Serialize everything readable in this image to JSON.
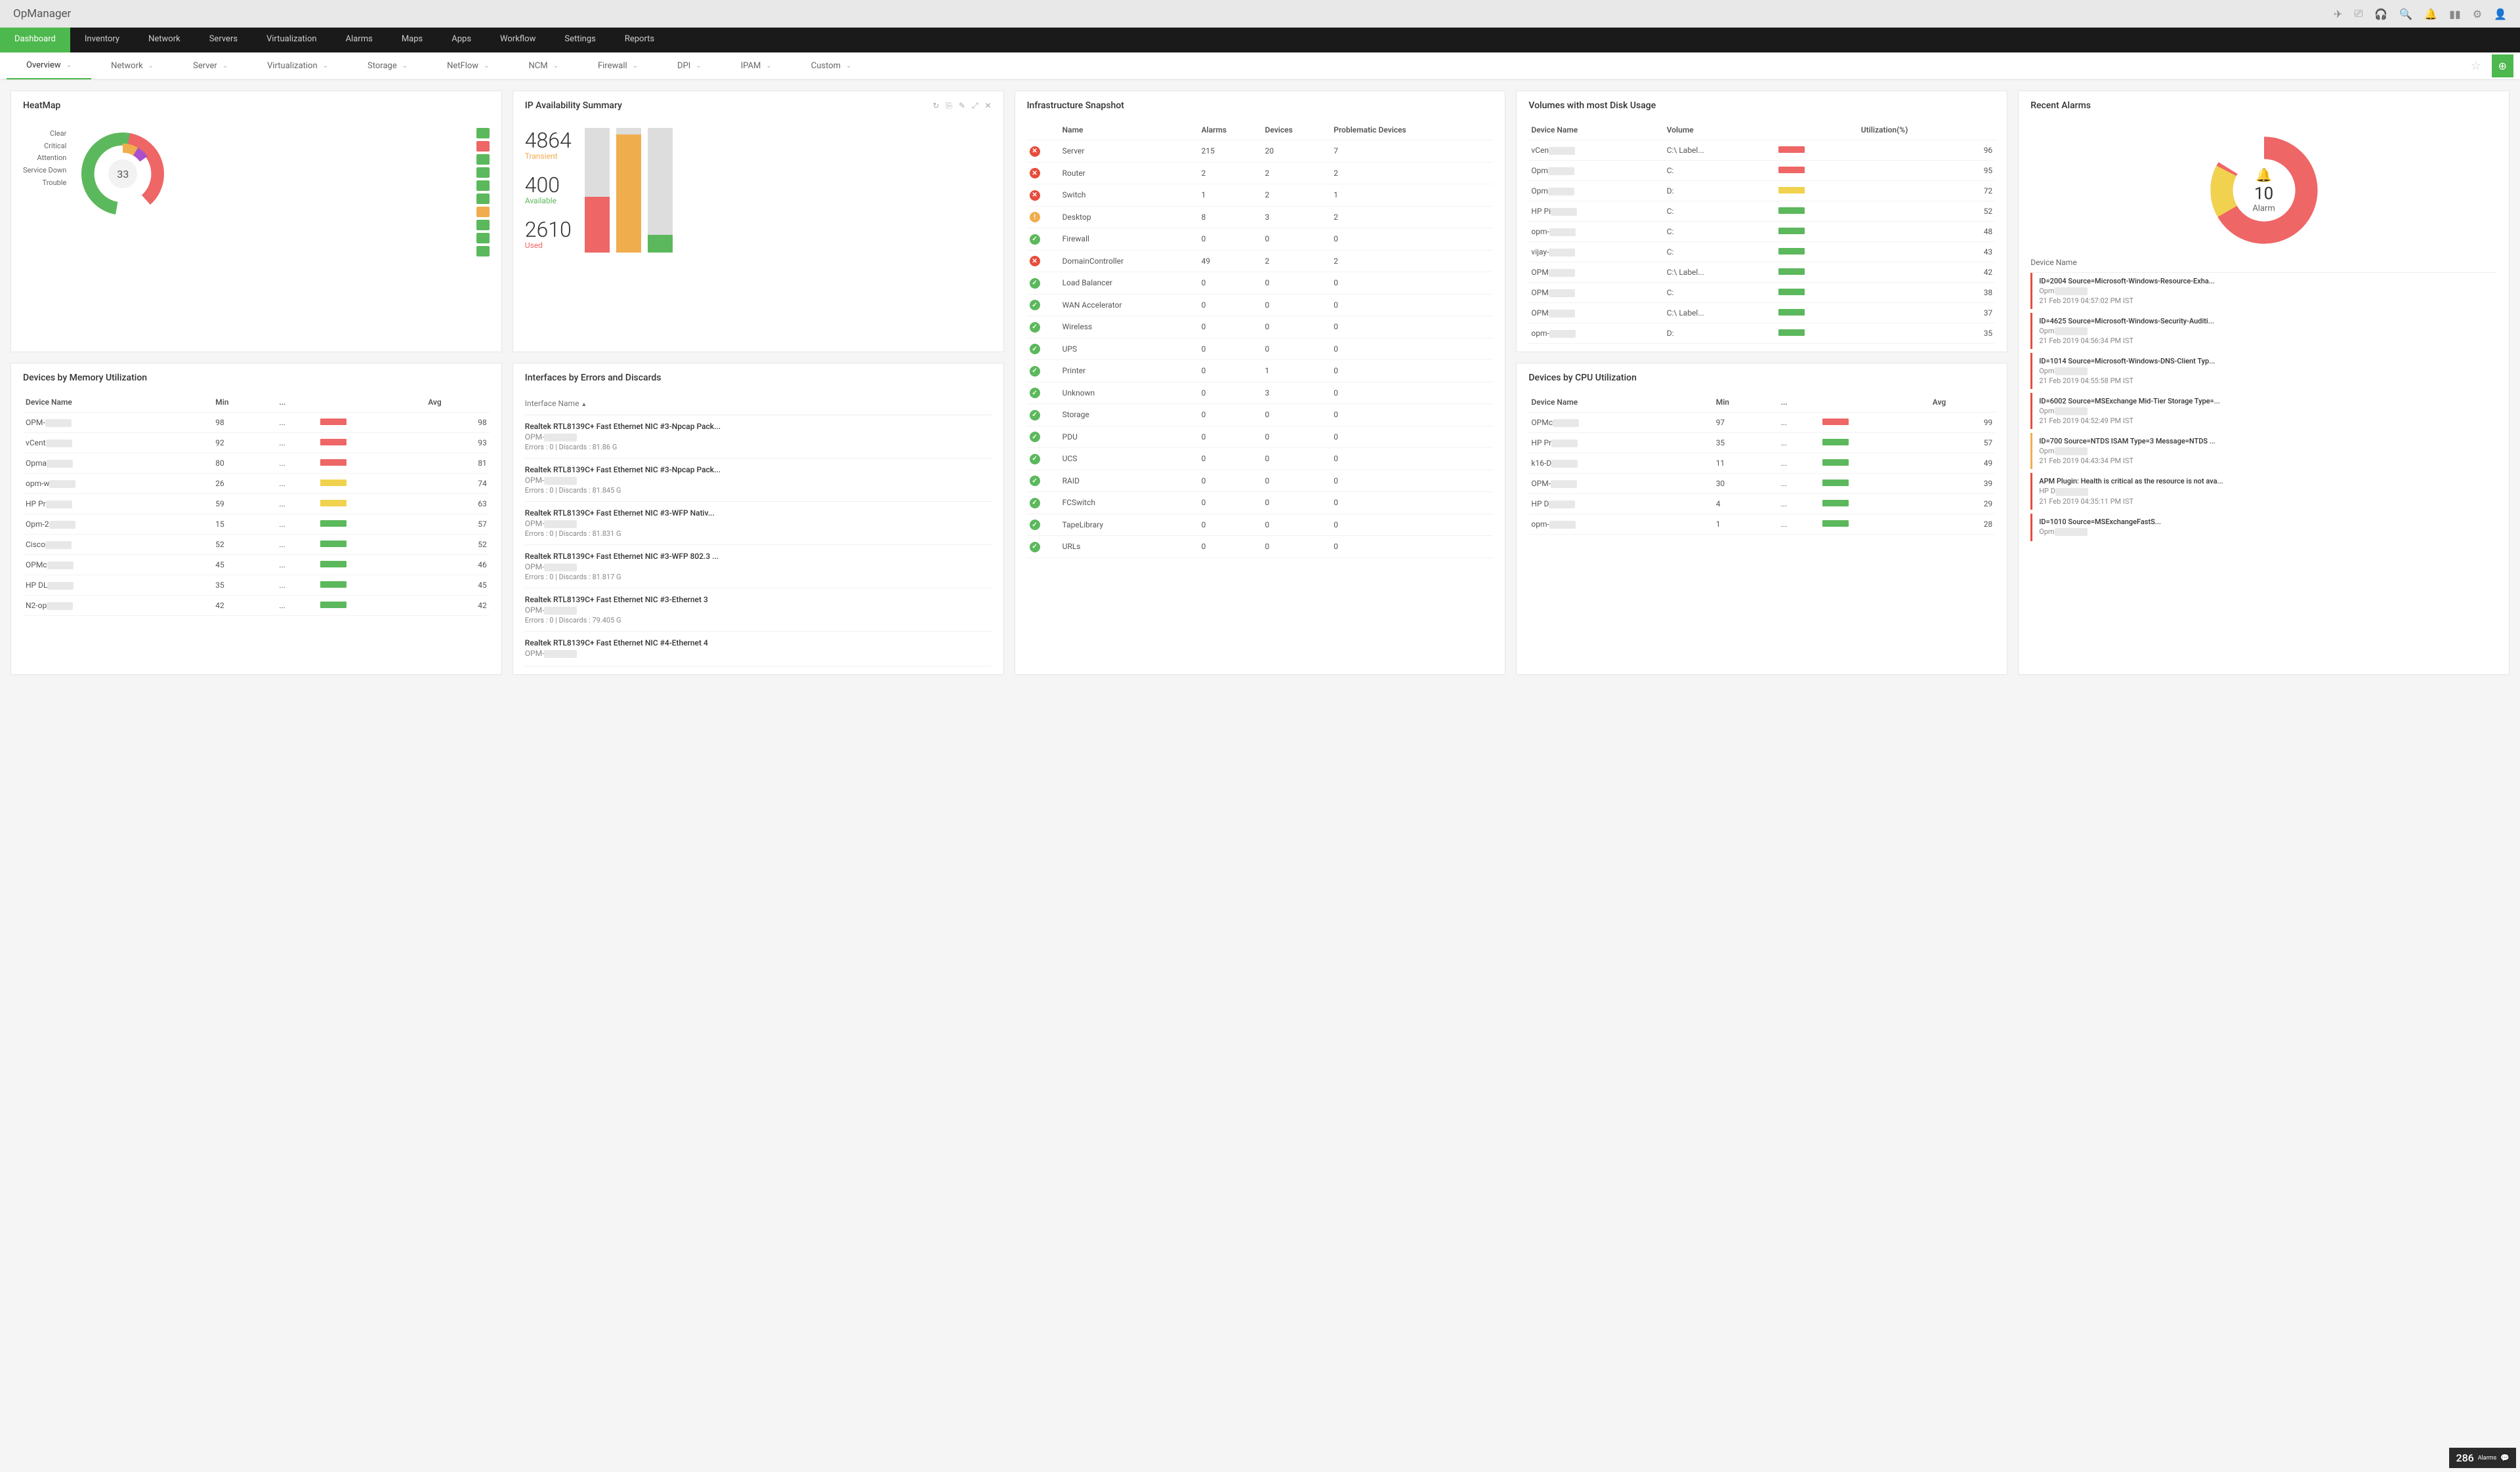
{
  "brand": "OpManager",
  "headerIcons": [
    "rocket",
    "screen",
    "headset",
    "search",
    "bell",
    "device",
    "gear",
    "user"
  ],
  "nav": [
    "Dashboard",
    "Inventory",
    "Network",
    "Servers",
    "Virtualization",
    "Alarms",
    "Maps",
    "Apps",
    "Workflow",
    "Settings",
    "Reports"
  ],
  "navActive": 0,
  "subnav": [
    "Overview",
    "Network",
    "Server",
    "Virtualization",
    "Storage",
    "NetFlow",
    "NCM",
    "Firewall",
    "DPI",
    "IPAM",
    "Custom"
  ],
  "subActive": 0,
  "heatmap": {
    "title": "HeatMap",
    "legend": [
      "Clear",
      "Critical",
      "Attention",
      "Service Down",
      "Trouble"
    ],
    "center": "33",
    "squares": [
      "g",
      "r",
      "g",
      "g",
      "g",
      "g",
      "o",
      "g",
      "g",
      "g"
    ]
  },
  "ipavail": {
    "title": "IP Availability Summary",
    "stats": [
      {
        "n": "4864",
        "l": "Transient",
        "c": "or"
      },
      {
        "n": "400",
        "l": "Available",
        "c": "gr"
      },
      {
        "n": "2610",
        "l": "Used",
        "c": "rd"
      }
    ]
  },
  "infra": {
    "title": "Infrastructure Snapshot",
    "cols": [
      "",
      "Name",
      "Alarms",
      "Devices",
      "Problematic Devices"
    ],
    "rows": [
      {
        "s": "err",
        "n": "Server",
        "a": "215",
        "d": "20",
        "p": "7"
      },
      {
        "s": "err",
        "n": "Router",
        "a": "2",
        "d": "2",
        "p": "2"
      },
      {
        "s": "err",
        "n": "Switch",
        "a": "1",
        "d": "2",
        "p": "1"
      },
      {
        "s": "warn",
        "n": "Desktop",
        "a": "8",
        "d": "3",
        "p": "2"
      },
      {
        "s": "ok",
        "n": "Firewall",
        "a": "0",
        "d": "0",
        "p": "0"
      },
      {
        "s": "err",
        "n": "DomainController",
        "a": "49",
        "d": "2",
        "p": "2"
      },
      {
        "s": "ok",
        "n": "Load Balancer",
        "a": "0",
        "d": "0",
        "p": "0"
      },
      {
        "s": "ok",
        "n": "WAN Accelerator",
        "a": "0",
        "d": "0",
        "p": "0"
      },
      {
        "s": "ok",
        "n": "Wireless",
        "a": "0",
        "d": "0",
        "p": "0"
      },
      {
        "s": "ok",
        "n": "UPS",
        "a": "0",
        "d": "0",
        "p": "0"
      },
      {
        "s": "ok",
        "n": "Printer",
        "a": "0",
        "d": "1",
        "p": "0"
      },
      {
        "s": "ok",
        "n": "Unknown",
        "a": "0",
        "d": "3",
        "p": "0"
      },
      {
        "s": "ok",
        "n": "Storage",
        "a": "0",
        "d": "0",
        "p": "0"
      },
      {
        "s": "ok",
        "n": "PDU",
        "a": "0",
        "d": "0",
        "p": "0"
      },
      {
        "s": "ok",
        "n": "UCS",
        "a": "0",
        "d": "0",
        "p": "0"
      },
      {
        "s": "ok",
        "n": "RAID",
        "a": "0",
        "d": "0",
        "p": "0"
      },
      {
        "s": "ok",
        "n": "FCSwitch",
        "a": "0",
        "d": "0",
        "p": "0"
      },
      {
        "s": "ok",
        "n": "TapeLibrary",
        "a": "0",
        "d": "0",
        "p": "0"
      },
      {
        "s": "ok",
        "n": "URLs",
        "a": "0",
        "d": "0",
        "p": "0"
      }
    ]
  },
  "vol": {
    "title": "Volumes with most Disk Usage",
    "cols": [
      "Device Name",
      "Volume",
      "",
      "Utilization(%)"
    ],
    "rows": [
      {
        "d": "vCen",
        "v": "C:\\ Label...",
        "c": "r",
        "u": "96"
      },
      {
        "d": "Opm",
        "v": "C:",
        "c": "r",
        "u": "95"
      },
      {
        "d": "Opm",
        "v": "D:",
        "c": "y",
        "u": "72"
      },
      {
        "d": "HP Pi",
        "v": "C:",
        "c": "g",
        "u": "52"
      },
      {
        "d": "opm-",
        "v": "C:",
        "c": "g",
        "u": "48"
      },
      {
        "d": "vijay-",
        "v": "C:",
        "c": "g",
        "u": "43"
      },
      {
        "d": "OPM",
        "v": "C:\\ Label...",
        "c": "g",
        "u": "42"
      },
      {
        "d": "OPM",
        "v": "C:",
        "c": "g",
        "u": "38"
      },
      {
        "d": "OPM",
        "v": "C:\\ Label...",
        "c": "g",
        "u": "37"
      },
      {
        "d": "opm-",
        "v": "D:",
        "c": "g",
        "u": "35"
      }
    ]
  },
  "alarms": {
    "title": "Recent Alarms",
    "count": "10",
    "label": "Alarm",
    "header": "Device Name",
    "items": [
      {
        "c": "r",
        "t": "ID=2004 Source=Microsoft-Windows-Resource-Exha...",
        "d": "Opm",
        "ts": "21 Feb 2019 04:57:02 PM IST"
      },
      {
        "c": "r",
        "t": "ID=4625 Source=Microsoft-Windows-Security-Auditi...",
        "d": "Opm",
        "ts": "21 Feb 2019 04:56:34 PM IST"
      },
      {
        "c": "r",
        "t": "ID=1014 Source=Microsoft-Windows-DNS-Client Typ...",
        "d": "Opm",
        "ts": "21 Feb 2019 04:55:58 PM IST"
      },
      {
        "c": "r",
        "t": "ID=6002 Source=MSExchange Mid-Tier Storage Type=...",
        "d": "Opm",
        "ts": "21 Feb 2019 04:52:49 PM IST"
      },
      {
        "c": "y",
        "t": "ID=700 Source=NTDS ISAM Type=3 Message=NTDS ...",
        "d": "Opm",
        "ts": "21 Feb 2019 04:43:34 PM IST"
      },
      {
        "c": "r",
        "t": "APM Plugin: Health is critical as the resource is not ava...",
        "d": "HP D",
        "ts": "21 Feb 2019 04:35:11 PM IST"
      },
      {
        "c": "r",
        "t": "ID=1010 Source=MSExchangeFastS...",
        "d": "Opm",
        "ts": ""
      }
    ]
  },
  "mem": {
    "title": "Devices by Memory Utilization",
    "cols": [
      "Device Name",
      "Min",
      "...",
      "",
      "Avg"
    ],
    "rows": [
      {
        "d": "OPM-",
        "m": "98",
        "c": "r",
        "a": "98"
      },
      {
        "d": "vCent",
        "m": "92",
        "c": "r",
        "a": "93"
      },
      {
        "d": "Opma",
        "m": "80",
        "c": "r",
        "a": "81"
      },
      {
        "d": "opm-w",
        "m": "26",
        "c": "y",
        "a": "74"
      },
      {
        "d": "HP Pr",
        "m": "59",
        "c": "y",
        "a": "63"
      },
      {
        "d": "Opm-2",
        "m": "15",
        "c": "g",
        "a": "57"
      },
      {
        "d": "Cisco",
        "m": "52",
        "c": "g",
        "a": "52"
      },
      {
        "d": "OPMc",
        "m": "45",
        "c": "g",
        "a": "46"
      },
      {
        "d": "HP DL",
        "m": "35",
        "c": "g",
        "a": "45"
      },
      {
        "d": "N2-op",
        "m": "42",
        "c": "g",
        "a": "42"
      }
    ]
  },
  "iface": {
    "title": "Interfaces by Errors and Discards",
    "header": "Interface Name",
    "rows": [
      {
        "n": "Realtek RTL8139C+ Fast Ethernet NIC #3-Npcap Pack...",
        "d": "OPM-",
        "s": "Errors : 0 | Discards : 81.86 G"
      },
      {
        "n": "Realtek RTL8139C+ Fast Ethernet NIC #3-Npcap Pack...",
        "d": "OPM-",
        "s": "Errors : 0 | Discards : 81.845 G"
      },
      {
        "n": "Realtek RTL8139C+ Fast Ethernet NIC #3-WFP Nativ...",
        "d": "OPM-",
        "s": "Errors : 0 | Discards : 81.831 G"
      },
      {
        "n": "Realtek RTL8139C+ Fast Ethernet NIC #3-WFP 802.3 ...",
        "d": "OPM-",
        "s": "Errors : 0 | Discards : 81.817 G"
      },
      {
        "n": "Realtek RTL8139C+ Fast Ethernet NIC #3-Ethernet 3",
        "d": "OPM-",
        "s": "Errors : 0 | Discards : 79.405 G"
      },
      {
        "n": "Realtek RTL8139C+ Fast Ethernet NIC #4-Ethernet 4",
        "d": "OPM-",
        "s": ""
      }
    ]
  },
  "cpu": {
    "title": "Devices by CPU Utilization",
    "cols": [
      "Device Name",
      "Min",
      "...",
      "",
      "Avg"
    ],
    "rows": [
      {
        "d": "OPMc",
        "m": "97",
        "c": "r",
        "a": "99"
      },
      {
        "d": "HP Pr",
        "m": "35",
        "c": "g",
        "a": "57"
      },
      {
        "d": "k16-D",
        "m": "11",
        "c": "g",
        "a": "49"
      },
      {
        "d": "OPM-",
        "m": "30",
        "c": "g",
        "a": "39"
      },
      {
        "d": "HP D",
        "m": "4",
        "c": "g",
        "a": "29"
      },
      {
        "d": "opm-",
        "m": "1",
        "c": "g",
        "a": "28"
      }
    ]
  },
  "footer": {
    "n": "286",
    "l": "Alarms"
  },
  "chart_data": [
    {
      "type": "pie",
      "title": "HeatMap",
      "categories": [
        "Clear",
        "Critical",
        "Attention",
        "Service Down",
        "Trouble"
      ],
      "center_value": 33
    },
    {
      "type": "bar",
      "title": "IP Availability Summary",
      "categories": [
        "Transient",
        "Available",
        "Used"
      ],
      "values": [
        4864,
        400,
        2610
      ]
    },
    {
      "type": "pie",
      "title": "Recent Alarms",
      "center_value": 10,
      "label": "Alarm"
    },
    {
      "type": "table",
      "title": "Devices by Memory Utilization",
      "columns": [
        "Device",
        "Min",
        "Avg"
      ],
      "rows": [
        [
          "OPM-",
          98,
          98
        ],
        [
          "vCent",
          92,
          93
        ],
        [
          "Opma",
          80,
          81
        ],
        [
          "opm-w",
          26,
          74
        ],
        [
          "HP Pr",
          59,
          63
        ],
        [
          "Opm-2",
          15,
          57
        ],
        [
          "Cisco",
          52,
          52
        ],
        [
          "OPMc",
          45,
          46
        ],
        [
          "HP DL",
          35,
          45
        ],
        [
          "N2-op",
          42,
          42
        ]
      ]
    },
    {
      "type": "table",
      "title": "Devices by CPU Utilization",
      "columns": [
        "Device",
        "Min",
        "Avg"
      ],
      "rows": [
        [
          "OPMc",
          97,
          99
        ],
        [
          "HP Pr",
          35,
          57
        ],
        [
          "k16-D",
          11,
          49
        ],
        [
          "OPM-",
          30,
          39
        ],
        [
          "HP D",
          4,
          29
        ],
        [
          "opm-",
          1,
          28
        ]
      ]
    },
    {
      "type": "table",
      "title": "Volumes with most Disk Usage",
      "columns": [
        "Device",
        "Volume",
        "Utilization%"
      ],
      "rows": [
        [
          "vCen",
          "C:\\ Label...",
          96
        ],
        [
          "Opm",
          "C:",
          95
        ],
        [
          "Opm",
          "D:",
          72
        ],
        [
          "HP Pi",
          "C:",
          52
        ],
        [
          "opm-",
          "C:",
          48
        ],
        [
          "vijay-",
          "C:",
          43
        ],
        [
          "OPM",
          "C:\\ Label...",
          42
        ],
        [
          "OPM",
          "C:",
          38
        ],
        [
          "OPM",
          "C:\\ Label...",
          37
        ],
        [
          "opm-",
          "D:",
          35
        ]
      ]
    }
  ]
}
